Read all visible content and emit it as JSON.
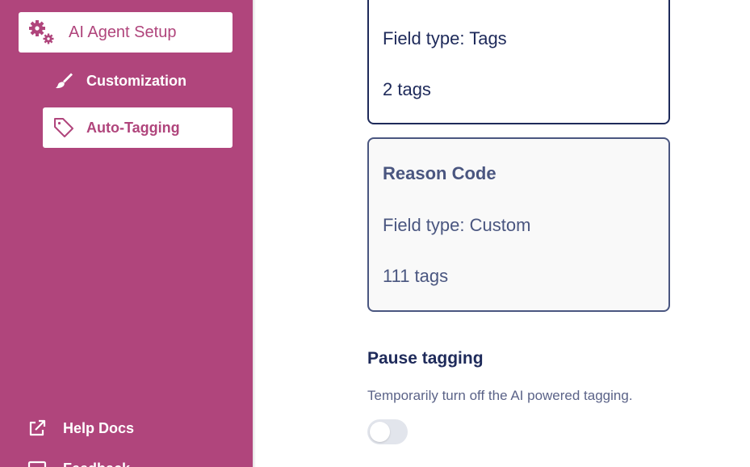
{
  "sidebar": {
    "background": "#b0457c",
    "primary": {
      "label": "AI Agent Setup",
      "icon": "gears-icon"
    },
    "sub_items": [
      {
        "label": "Customization",
        "icon": "paintbrush-icon",
        "active": false
      },
      {
        "label": "Auto-Tagging",
        "icon": "tag-icon",
        "active": true
      }
    ],
    "bottom_items": [
      {
        "label": "Help Docs",
        "icon": "external-link-icon"
      },
      {
        "label": "Feedback",
        "icon": "message-icon"
      }
    ]
  },
  "main": {
    "cards": [
      {
        "field_type": "Field type: Tags",
        "tag_count": "2 tags",
        "selected": true
      },
      {
        "title": "Reason Code",
        "field_type": "Field type: Custom",
        "tag_count": "111 tags",
        "selected": false
      }
    ],
    "pause": {
      "title": "Pause tagging",
      "description": "Temporarily turn off the AI powered tagging.",
      "toggle_on": false
    }
  }
}
